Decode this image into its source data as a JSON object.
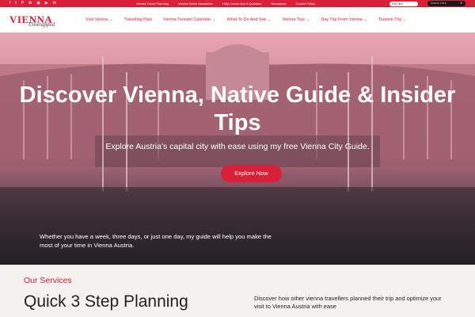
{
  "topbar": {
    "social_icons": [
      "facebook-icon",
      "twitter-icon",
      "pinterest-icon",
      "flickr-icon",
      "rss-icon",
      "youtube-icon",
      "mail-icon"
    ],
    "social_glyphs": [
      "f",
      "t",
      "P",
      "✿",
      "◉",
      "▶",
      "✉"
    ],
    "links": [
      "Vienna Travel Planning",
      "Vienna Notes Newsletter",
      "Help Center Ask A Question",
      "Resources",
      "Cookie Policy"
    ],
    "language": "ENG",
    "search_placeholder": "Search Here",
    "colors": {
      "bar": "#d8203a"
    }
  },
  "nav": {
    "logo_main": "VIENNA",
    "logo_script": "Unwrapped",
    "items": [
      {
        "label": "Visit Vienna",
        "has_dropdown": true
      },
      {
        "label": "Travelling Plan",
        "has_dropdown": false
      },
      {
        "label": "Vienna Tourism Calendar",
        "has_dropdown": true
      },
      {
        "label": "What To Do And See",
        "has_dropdown": true
      },
      {
        "label": "Vienna Tour",
        "has_dropdown": true
      },
      {
        "label": "Day Trip From Vienna",
        "has_dropdown": true
      },
      {
        "label": "Tourism Trip",
        "has_dropdown": true
      }
    ]
  },
  "hero": {
    "heading": "Discover Vienna, Native Guide & Insider Tips",
    "subheading": "Explore Austria's capital city with ease using my free Vienna City Guide.",
    "cta_label": "Explore Now",
    "blurb": "Whether you have a week, three days, or just one day, my guide will help you make the most of your time in Vienna Austria."
  },
  "services": {
    "kicker": "Our Services",
    "title": "Quick 3 Step Planning",
    "description": "Discover how other vienna travellers planned their trip and optimize your visit to Vienna Austria with ease"
  }
}
